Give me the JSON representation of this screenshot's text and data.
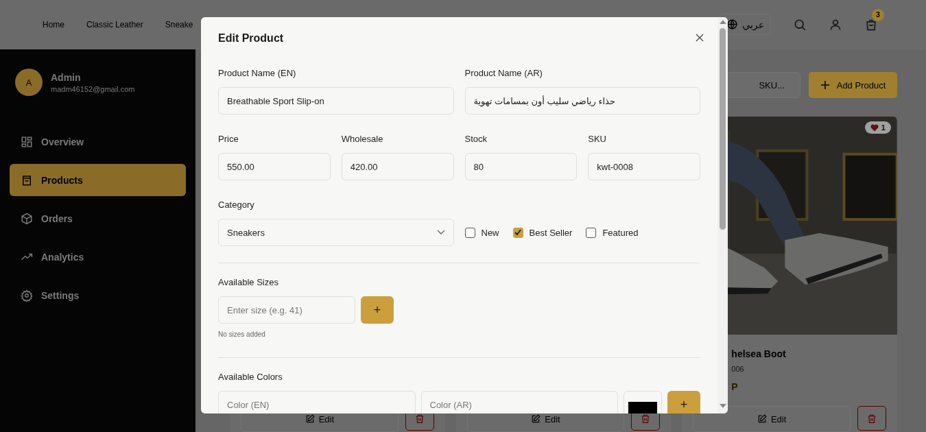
{
  "header": {
    "nav": [
      {
        "label": "Home"
      },
      {
        "label": "Classic Leather"
      },
      {
        "label": "Sneake"
      }
    ],
    "language": "عربي",
    "cart_count": "3"
  },
  "sidebar": {
    "user": {
      "initial": "A",
      "name": "Admin",
      "email": "madm46152@gmail.com"
    },
    "items": [
      {
        "label": "Overview",
        "kind": "grid",
        "selected": false
      },
      {
        "label": "Products",
        "kind": "bag",
        "selected": true
      },
      {
        "label": "Orders",
        "kind": "box",
        "selected": false
      },
      {
        "label": "Analytics",
        "kind": "trend",
        "selected": false
      },
      {
        "label": "Settings",
        "kind": "gear",
        "selected": false
      }
    ]
  },
  "toolbar": {
    "search_placeholder": "SKU...",
    "add_button": "Add Product"
  },
  "products": [
    {
      "edit": "Edit"
    },
    {
      "edit": "Edit"
    },
    {
      "likes": "1",
      "name": "helsea Boot",
      "sku": "006",
      "price": "P",
      "edit": "Edit"
    }
  ],
  "modal": {
    "title": "Edit Product",
    "name_en": {
      "label": "Product Name (EN)",
      "value": "Breathable Sport Slip-on"
    },
    "name_ar": {
      "label": "Product Name (AR)",
      "value": "حذاء رياضي سليب أون بمسامات تهوية"
    },
    "numbers": [
      {
        "label": "Price",
        "value": "550.00"
      },
      {
        "label": "Wholesale",
        "value": "420.00"
      },
      {
        "label": "Stock",
        "value": "80"
      },
      {
        "label": "SKU",
        "value": "kwt-0008"
      }
    ],
    "category": {
      "label": "Category",
      "value": "Sneakers"
    },
    "flags": [
      {
        "label": "New",
        "checked": false
      },
      {
        "label": "Best Seller",
        "checked": true
      },
      {
        "label": "Featured",
        "checked": false
      }
    ],
    "sizes": {
      "label": "Available Sizes",
      "placeholder": "Enter size (e.g. 41)",
      "add": "+",
      "empty": "No sizes added"
    },
    "colors": {
      "label": "Available Colors",
      "en_placeholder": "Color (EN)",
      "ar_placeholder": "Color (AR)",
      "color": "#000000",
      "add": "+"
    }
  }
}
